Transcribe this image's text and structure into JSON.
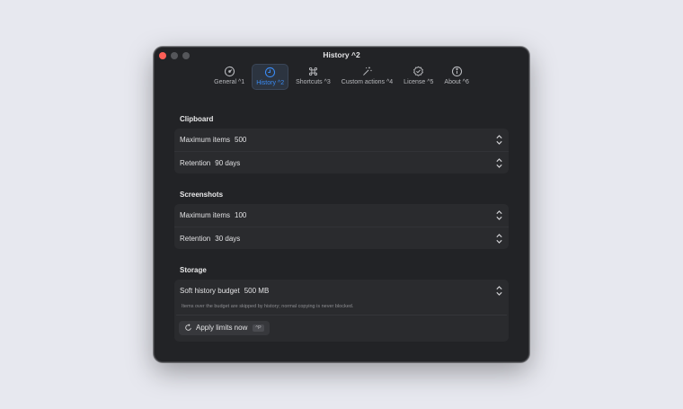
{
  "window": {
    "title": "History  ^2"
  },
  "tabs": [
    {
      "label": "General  ^1",
      "icon": "gauge-icon"
    },
    {
      "label": "History  ^2",
      "icon": "clock-icon",
      "active": true
    },
    {
      "label": "Shortcuts  ^3",
      "icon": "command-icon"
    },
    {
      "label": "Custom actions  ^4",
      "icon": "magic-wand-icon"
    },
    {
      "label": "License  ^5",
      "icon": "seal-check-icon"
    },
    {
      "label": "About  ^6",
      "icon": "info-icon"
    }
  ],
  "clipboard": {
    "title": "Clipboard",
    "max_items_label": "Maximum items",
    "max_items_value": "500",
    "retention_label": "Retention",
    "retention_value": "90 days"
  },
  "screenshots": {
    "title": "Screenshots",
    "max_items_label": "Maximum items",
    "max_items_value": "100",
    "retention_label": "Retention",
    "retention_value": "30 days"
  },
  "storage": {
    "title": "Storage",
    "budget_label": "Soft history budget",
    "budget_value": "500 MB",
    "note": "Items over the budget are skipped by history; normal copying is never blocked.",
    "apply_label": "Apply limits now",
    "apply_shortcut": "^P"
  },
  "colors": {
    "accent": "#3a8bf5",
    "window_bg": "#222326",
    "group_bg": "#2a2b2e"
  }
}
